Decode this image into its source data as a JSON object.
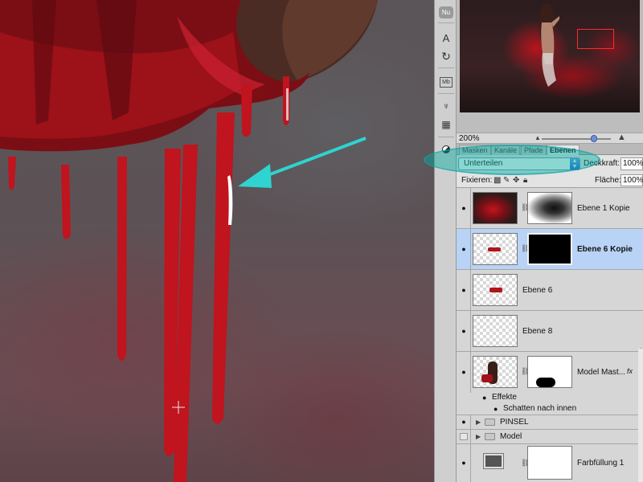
{
  "navigator": {
    "zoom": "200%"
  },
  "tabs": [
    {
      "label": "Masken"
    },
    {
      "label": "Kanäle"
    },
    {
      "label": "Pfade"
    },
    {
      "label": "Ebenen"
    }
  ],
  "layers_panel": {
    "blend_mode": "Unterteilen",
    "opacity_label": "Deckkraft:",
    "opacity_value": "100%",
    "lock_label": "Fixieren:",
    "fill_label": "Fläche:",
    "fill_value": "100%",
    "layers": [
      {
        "name": "Ebene 1 Kopie"
      },
      {
        "name": "Ebene 6 Kopie"
      },
      {
        "name": "Ebene 6"
      },
      {
        "name": "Ebene 8"
      },
      {
        "name": "Model Mast..."
      }
    ],
    "effects_label": "Effekte",
    "effect_item": "Schatten nach innen",
    "fx_label": "fx",
    "groups": [
      {
        "name": "PINSEL"
      },
      {
        "name": "Model"
      }
    ],
    "fill_layer": {
      "name": "Farbfüllung 1"
    }
  },
  "tools": {
    "toolbar_top": "Nu",
    "type_tool": "A",
    "mini_bridge": "Mb"
  },
  "colors": {
    "highlight": "#19b5b0",
    "arrow": "#2fd3d0",
    "selected_row": "#b8d3f5",
    "blood_red": "#c0141e"
  }
}
